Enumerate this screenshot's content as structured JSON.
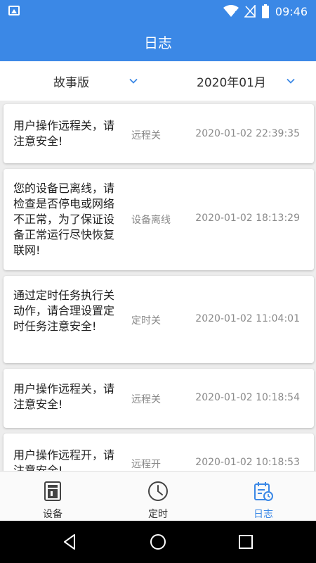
{
  "status_bar": {
    "time": "09:46"
  },
  "app_bar": {
    "title": "日志"
  },
  "filters": {
    "story": {
      "label": "故事版"
    },
    "month": {
      "label": "2020年01月"
    }
  },
  "logs": [
    {
      "message": "用户操作远程关，请注意安全!",
      "type": "远程关",
      "time": "2020-01-02 22:39:35"
    },
    {
      "message": "您的设备已离线，请检查是否停电或网络不正常，为了保证设备正常运行尽快恢复联网!",
      "type": "设备离线",
      "time": "2020-01-02 18:13:29"
    },
    {
      "message": "通过定时任务执行关动作，请合理设置定时任务注意安全!",
      "type": "定时关",
      "time": "2020-01-02 11:04:01"
    },
    {
      "message": "用户操作远程关，请注意安全!",
      "type": "远程关",
      "time": "2020-01-02 10:18:54"
    },
    {
      "message": "用户操作远程开，请注意安全!",
      "type": "远程开",
      "time": "2020-01-02 10:18:53"
    }
  ],
  "tabs": [
    {
      "label": "设备",
      "icon": "device-icon",
      "active": false
    },
    {
      "label": "定时",
      "icon": "clock-icon",
      "active": false
    },
    {
      "label": "日志",
      "icon": "calendar-log-icon",
      "active": true
    }
  ],
  "colors": {
    "primary": "#3b88e6",
    "background": "#ededed",
    "text_secondary": "#8a8a8a"
  }
}
